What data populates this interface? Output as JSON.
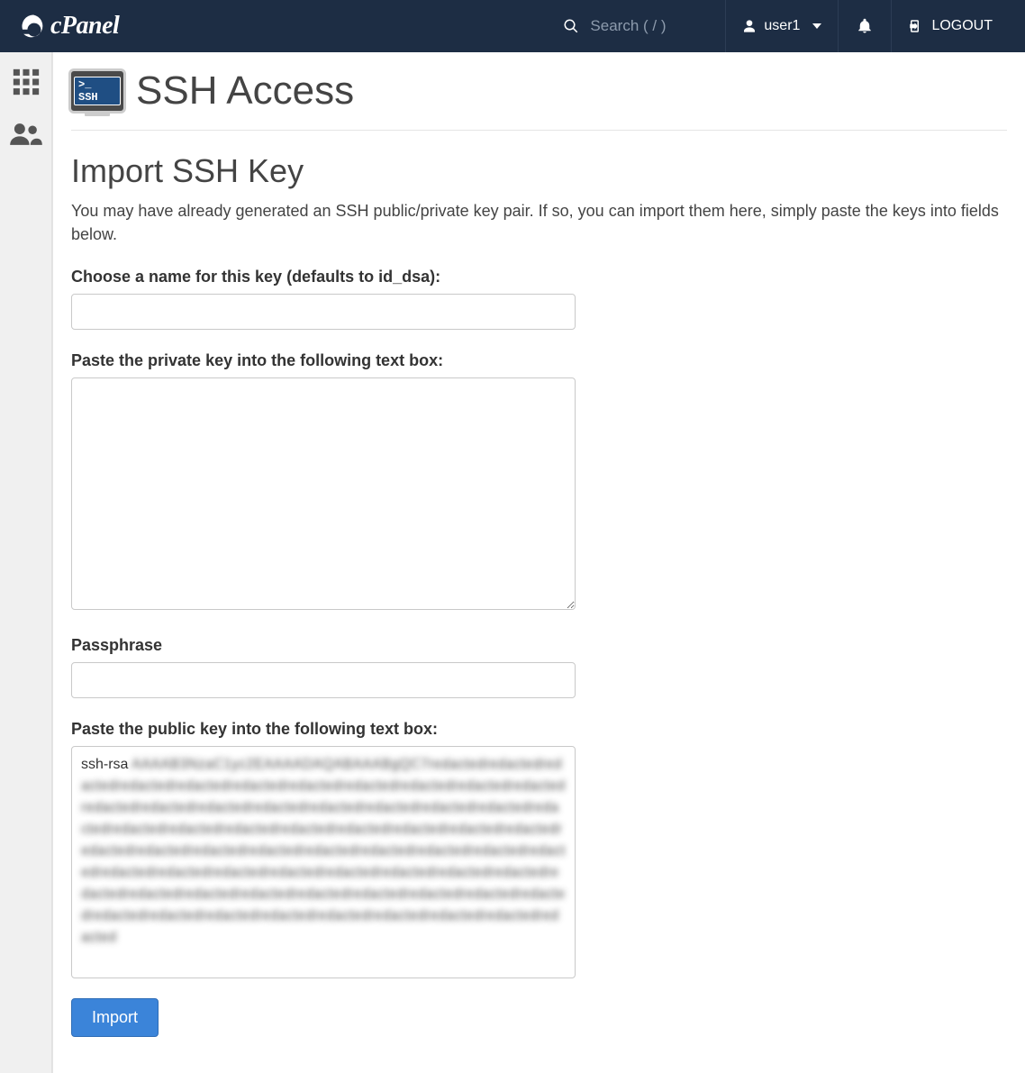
{
  "brand": {
    "name": "cPanel"
  },
  "topbar": {
    "search": {
      "placeholder": "Search ( / )"
    },
    "user": {
      "label": "user1"
    },
    "logout": {
      "label": "LOGOUT"
    }
  },
  "page": {
    "icon_badge": ">_ SSH",
    "title": "SSH Access"
  },
  "section": {
    "title": "Import SSH Key",
    "description": "You may have already generated an SSH public/private key pair. If so, you can import them here, simply paste the keys into fields below."
  },
  "form": {
    "key_name": {
      "label": "Choose a name for this key (defaults to id_dsa):",
      "value": ""
    },
    "private_key": {
      "label": "Paste the private key into the following text box:",
      "value": ""
    },
    "passphrase": {
      "label": "Passphrase",
      "value": ""
    },
    "public_key": {
      "label": "Paste the public key into the following text box:",
      "value_clear": "ssh-rsa",
      "value_blurred": "AAAAB3NzaC1yc2EAAAADAQABAAABgQC7redactedredactedredactedredactedredactedredactedredactedredactedredactedredactedredactedredactedredactedredactedredactedredactedredactedredactedredactedredactedredactedredactedredactedredactedredactedredactedredactedredactedredactedredactedredactedredactedredactedredactedredactedredactedredactedredactedredactedredactedredactedredactedredactedredactedredactedredactedredactedredactedredactedredactedredactedredactedredactedredactedredactedredactedredactedredactedredactedredactedredactedredactedredacted"
    },
    "submit": {
      "label": "Import"
    }
  }
}
